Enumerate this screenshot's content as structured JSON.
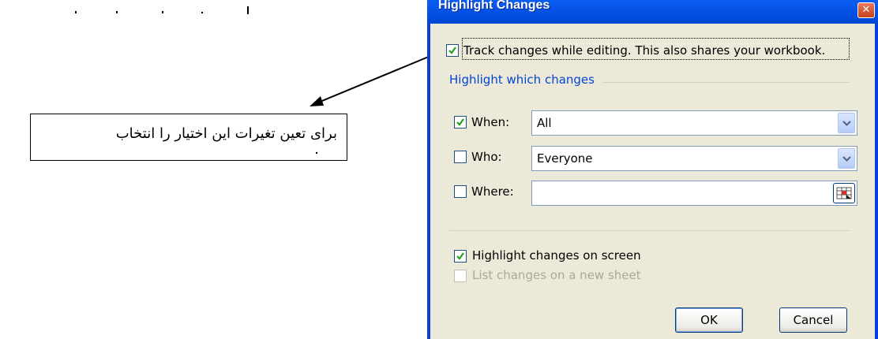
{
  "callout": {
    "text": "برای تعین تغیرات این اختیار را انتخاب"
  },
  "dialog": {
    "title": "Highlight Changes",
    "close_label": "✕",
    "track_changes": {
      "label": "Track changes while editing. This also shares your workbook.",
      "checked": true
    },
    "section_title": "Highlight which changes",
    "when": {
      "label": "When:",
      "checked": true,
      "value": "All"
    },
    "who": {
      "label": "Who:",
      "checked": false,
      "value": "Everyone"
    },
    "where": {
      "label": "Where:",
      "checked": false,
      "value": ""
    },
    "highlight_on_screen": {
      "label": "Highlight changes on screen",
      "checked": true
    },
    "list_on_new_sheet": {
      "label": "List changes on a new sheet",
      "checked": false,
      "enabled": false
    },
    "ok_label": "OK",
    "cancel_label": "Cancel"
  },
  "colors": {
    "titlebar": "#0a5df2",
    "dialog_face": "#ece9d8",
    "section_title": "#0046d5",
    "checkmark": "#21a121"
  }
}
